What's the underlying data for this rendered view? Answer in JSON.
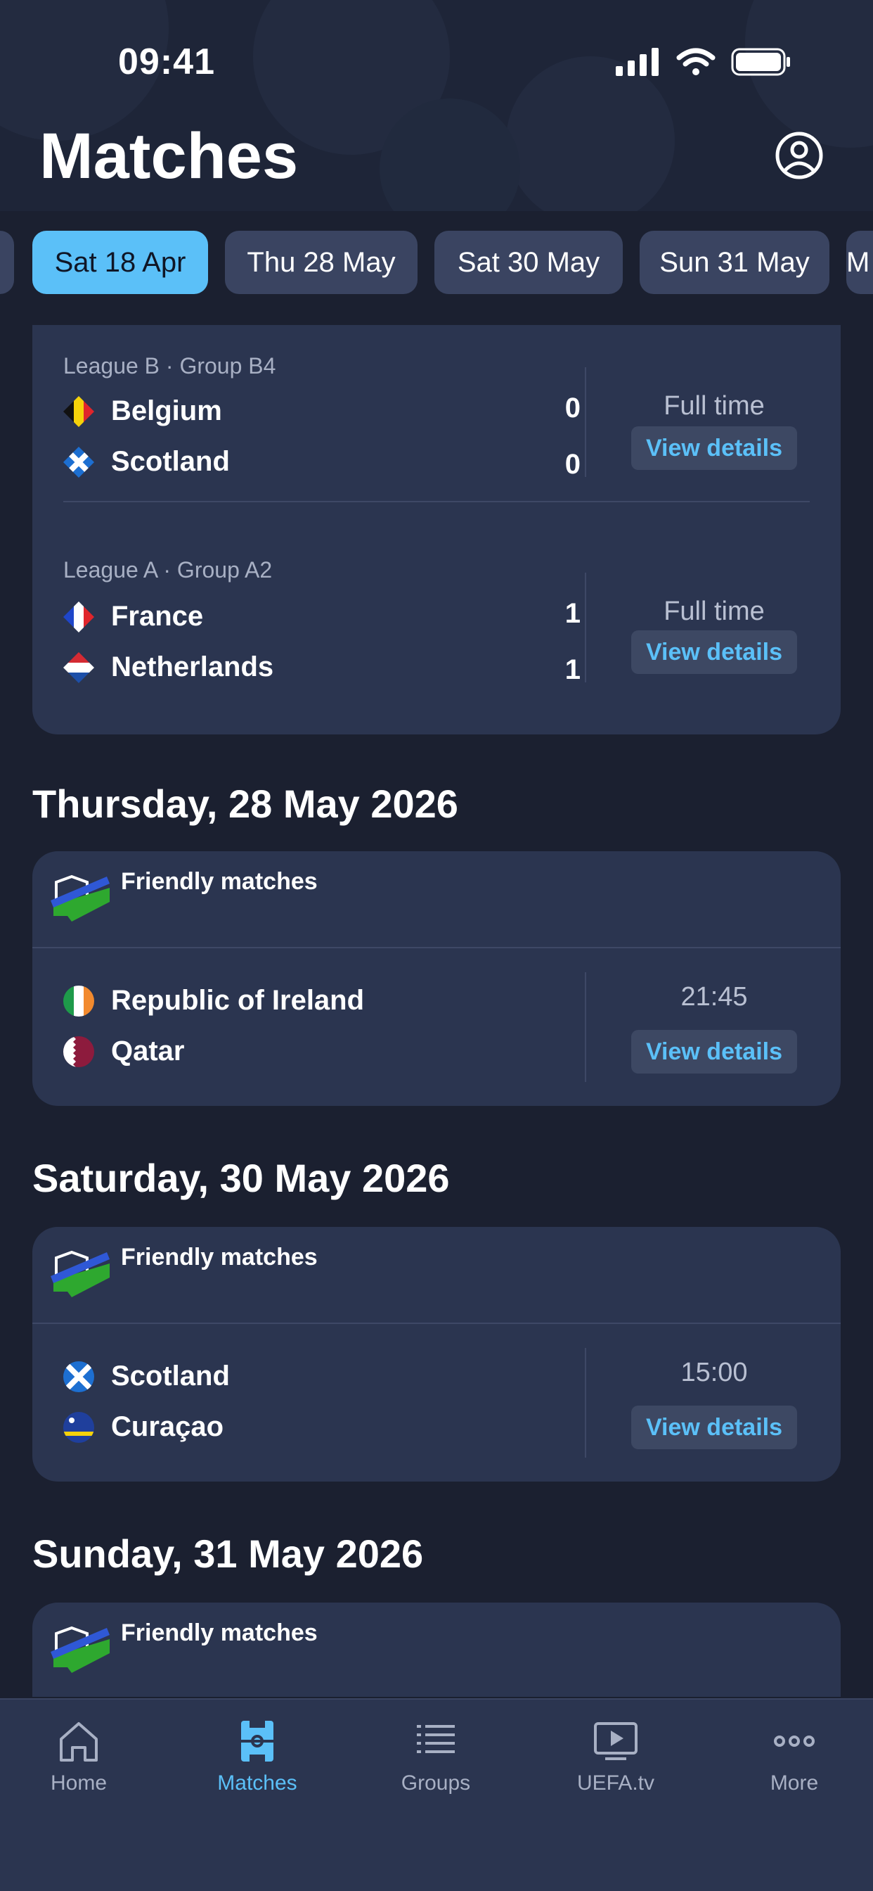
{
  "status_bar": {
    "time": "09:41"
  },
  "header": {
    "title": "Matches"
  },
  "date_tabs": [
    {
      "label": "Sat 18 Apr",
      "active": true
    },
    {
      "label": "Thu 28 May",
      "active": false
    },
    {
      "label": "Sat 30 May",
      "active": false
    },
    {
      "label": "Sun 31 May",
      "active": false
    },
    {
      "label": "M",
      "active": false
    }
  ],
  "first_card": {
    "matches": [
      {
        "group": "League B · Group B4",
        "home": {
          "name": "Belgium",
          "score": "0"
        },
        "away": {
          "name": "Scotland",
          "score": "0"
        },
        "status": "Full time",
        "button": "View details"
      },
      {
        "group": "League A · Group A2",
        "home": {
          "name": "France",
          "score": "1"
        },
        "away": {
          "name": "Netherlands",
          "score": "1"
        },
        "status": "Full time",
        "button": "View details"
      }
    ]
  },
  "days": [
    {
      "heading": "Thursday, 28 May 2026",
      "competition": "Friendly matches",
      "home": "Republic of Ireland",
      "away": "Qatar",
      "status": "21:45",
      "button": "View details"
    },
    {
      "heading": "Saturday, 30 May 2026",
      "competition": "Friendly matches",
      "home": "Scotland",
      "away": "Curaçao",
      "status": "15:00",
      "button": "View details"
    },
    {
      "heading": "Sunday, 31 May 2026",
      "competition": "Friendly matches"
    }
  ],
  "nav": {
    "items": [
      {
        "label": "Home",
        "icon": "home-icon",
        "active": false
      },
      {
        "label": "Matches",
        "icon": "pitch-icon",
        "active": true
      },
      {
        "label": "Groups",
        "icon": "list-icon",
        "active": false
      },
      {
        "label": "UEFA.tv",
        "icon": "play-screen-icon",
        "active": false
      },
      {
        "label": "More",
        "icon": "more-dots-icon",
        "active": false
      }
    ]
  },
  "colors": {
    "background": "#1b2030",
    "card": "#2b3550",
    "accent": "#5bc0f8",
    "tab": "#3a4461"
  }
}
